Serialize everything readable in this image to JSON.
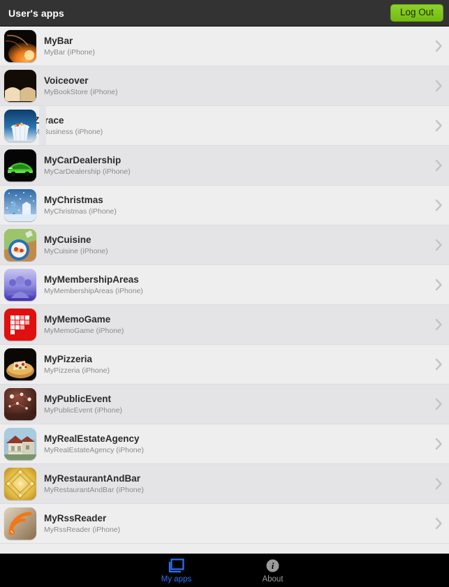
{
  "navbar": {
    "title": "User's apps",
    "logout_label": "Log Out",
    "background": "#333333",
    "logout_color": "#7ac81e"
  },
  "list": {
    "chevron_icon": "chevron-right-icon",
    "rows": [
      {
        "title": "MyBar",
        "subtitle": "MyBar (iPhone)",
        "icon": "mybar-icon"
      },
      {
        "title": "Voiceover",
        "subtitle": "MyBookStore (iPhone)",
        "icon": "mybookstore-icon"
      },
      {
        "title": "ZTrace",
        "subtitle": "MyBusiness (iPhone)",
        "icon": "mybusiness-icon"
      },
      {
        "title": "MyCarDealership",
        "subtitle": "MyCarDealership (iPhone)",
        "icon": "mycardealership-icon"
      },
      {
        "title": "MyChristmas",
        "subtitle": "MyChristmas (iPhone)",
        "icon": "mychristmas-icon"
      },
      {
        "title": "MyCuisine",
        "subtitle": "MyCuisine (iPhone)",
        "icon": "mycuisine-icon"
      },
      {
        "title": "MyMembershipAreas",
        "subtitle": "MyMembershipAreas (iPhone)",
        "icon": "mymembershipareas-icon"
      },
      {
        "title": "MyMemoGame",
        "subtitle": "MyMemoGame (iPhone)",
        "icon": "mymemogame-icon"
      },
      {
        "title": "MyPizzeria",
        "subtitle": "MyPizzeria (iPhone)",
        "icon": "mypizzeria-icon"
      },
      {
        "title": "MyPublicEvent",
        "subtitle": "MyPublicEvent (iPhone)",
        "icon": "mypublicevent-icon"
      },
      {
        "title": "MyRealEstateAgency",
        "subtitle": "MyRealEstateAgency (iPhone)",
        "icon": "myrealestateagency-icon"
      },
      {
        "title": "MyRestaurantAndBar",
        "subtitle": "MyRestaurantAndBar (iPhone)",
        "icon": "myrestaurantandbar-icon"
      },
      {
        "title": "MyRssReader",
        "subtitle": "MyRssReader (iPhone)",
        "icon": "myrssreader-icon"
      }
    ]
  },
  "tabbar": {
    "background": "#000000",
    "active_color": "#2a72f0",
    "inactive_color": "#9b9b9b",
    "tabs": [
      {
        "label": "My apps",
        "icon": "windows-icon",
        "active": true
      },
      {
        "label": "About",
        "icon": "info-circle-icon",
        "active": false
      }
    ]
  }
}
